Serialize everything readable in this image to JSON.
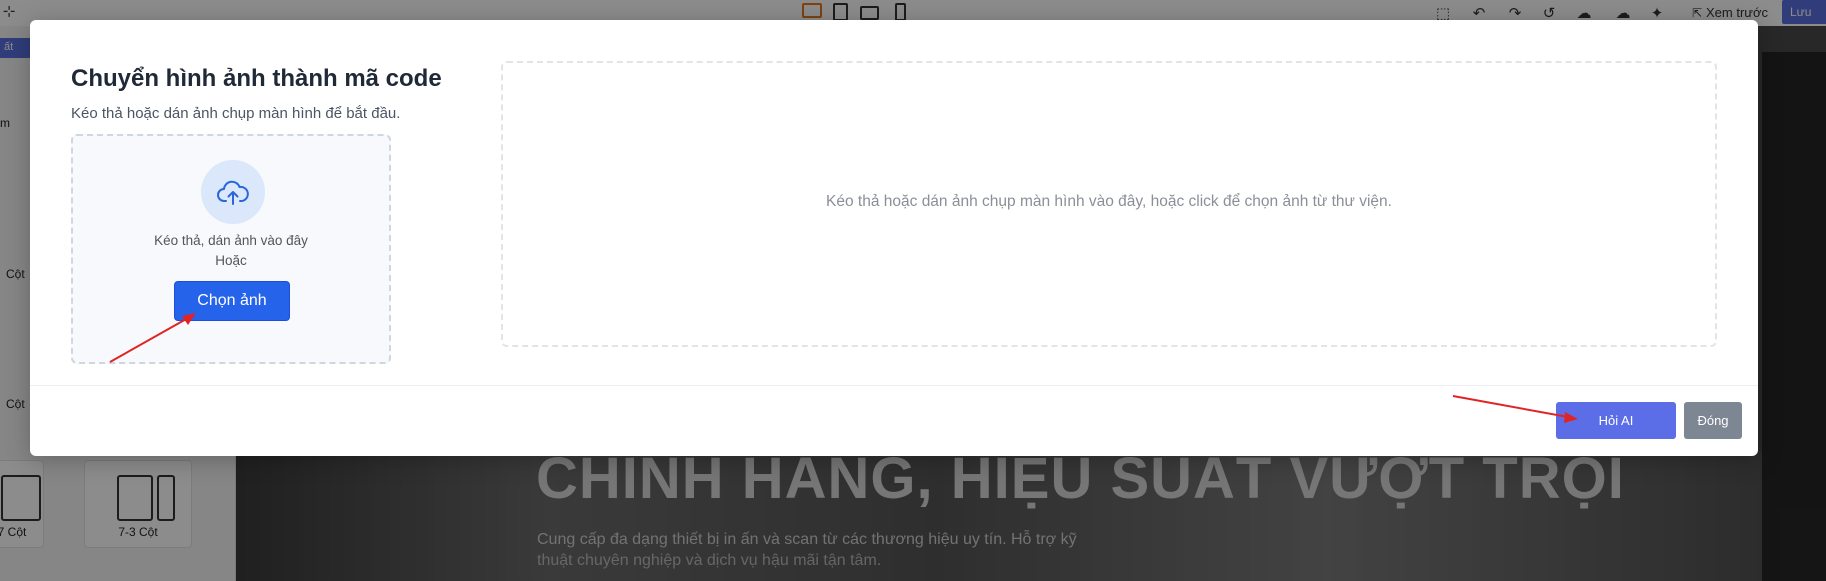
{
  "topbar": {
    "preview_label": "Xem trước",
    "save_label": "Lưu",
    "icons": [
      "desktop-icon",
      "tablet-icon",
      "tablet-landscape-icon",
      "mobile-icon",
      "select-box-icon",
      "undo-icon",
      "redo-icon",
      "history-icon",
      "cloud-download-icon",
      "cloud-upload-icon",
      "magic-icon"
    ]
  },
  "left_panel": {
    "tab_label": "ất",
    "labels": [
      "m",
      "Cột",
      "Cột"
    ],
    "layouts": [
      {
        "label": "7 Cột"
      },
      {
        "label": "7-3 Cột"
      }
    ]
  },
  "canvas": {
    "hero_title": "CHÍNH HÃNG, HIỆU SUẤT VƯỢT TRỘI",
    "hero_subtitle": "Cung cấp đa dạng thiết bị in ấn và scan từ các thương hiệu uy tín. Hỗ trợ kỹ",
    "hero_subtitle_2": "thuật chuyên nghiệp và dịch vụ hậu mãi tận tâm."
  },
  "modal": {
    "title": "Chuyển hình ảnh thành mã code",
    "subtitle": "Kéo thả hoặc dán ảnh chụp màn hình để bắt đầu.",
    "dropzone_small": {
      "line1": "Kéo thả, dán ảnh vào đây",
      "line2": "Hoặc",
      "button_label": "Chọn ảnh"
    },
    "dropzone_big_hint": "Kéo thả hoặc dán ảnh chụp màn hình vào đây, hoặc click để chọn ảnh từ thư viện.",
    "footer": {
      "ask_ai_label": "Hỏi AI",
      "close_label": "Đóng"
    }
  },
  "colors": {
    "primary_button": "#2563eb",
    "ask_ai_button": "#5b6ee8",
    "close_button": "#7d8793",
    "annotation_arrow": "#e02424"
  }
}
